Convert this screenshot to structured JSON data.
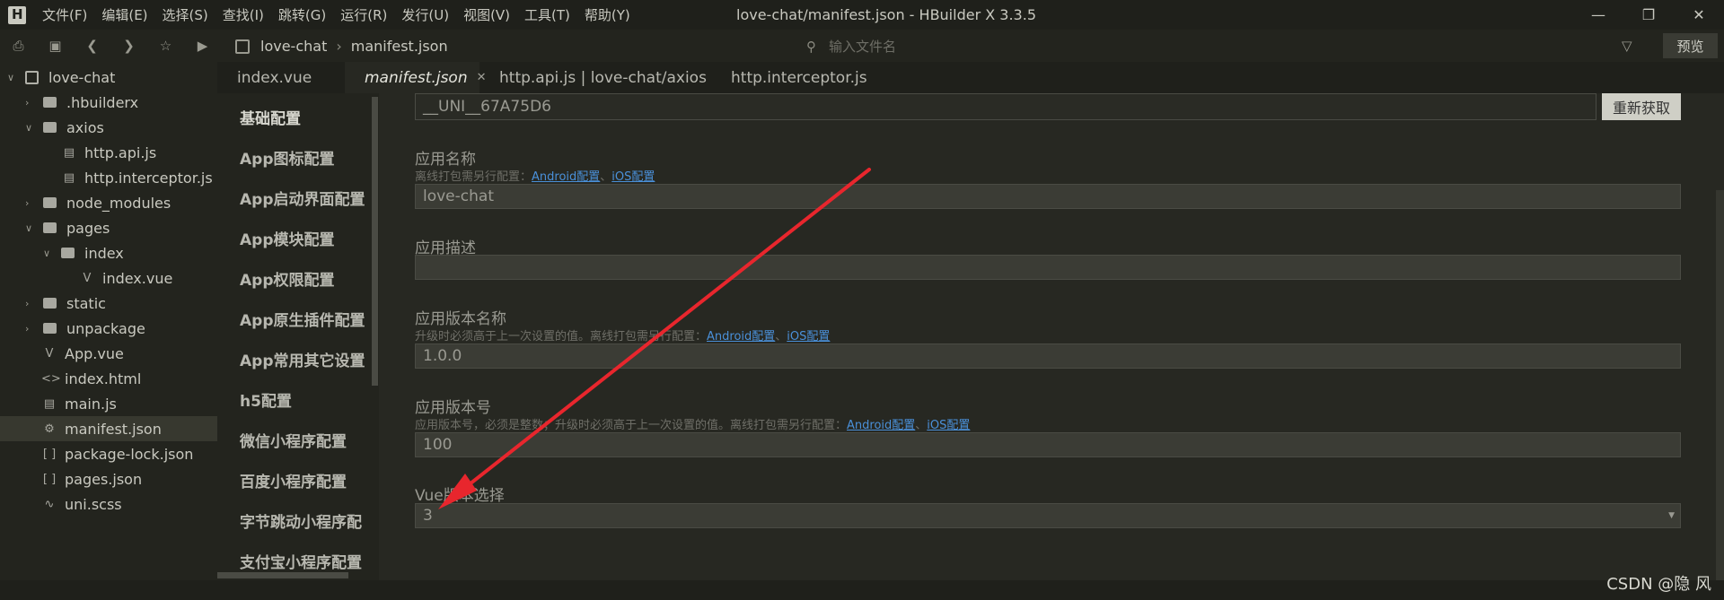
{
  "app": {
    "window_title": "love-chat/manifest.json - HBuilder X 3.3.5",
    "menus": [
      "文件(F)",
      "编辑(E)",
      "选择(S)",
      "查找(I)",
      "跳转(G)",
      "运行(R)",
      "发行(U)",
      "视图(V)",
      "工具(T)",
      "帮助(Y)"
    ]
  },
  "toolbar": {
    "breadcrumb": [
      "love-chat",
      "manifest.json"
    ],
    "file_search_placeholder": "输入文件名",
    "preview_label": "预览"
  },
  "file_tree": [
    {
      "label": "love-chat",
      "type": "project",
      "expanded": true
    },
    {
      "label": ".hbuilderx",
      "type": "folder",
      "expanded": false
    },
    {
      "label": "axios",
      "type": "folder",
      "expanded": true
    },
    {
      "label": "http.api.js",
      "type": "file"
    },
    {
      "label": "http.interceptor.js",
      "type": "file"
    },
    {
      "label": "node_modules",
      "type": "folder",
      "expanded": false
    },
    {
      "label": "pages",
      "type": "folder",
      "expanded": true
    },
    {
      "label": "index",
      "type": "folder",
      "expanded": true
    },
    {
      "label": "index.vue",
      "type": "vue"
    },
    {
      "label": "static",
      "type": "folder",
      "expanded": false
    },
    {
      "label": "unpackage",
      "type": "folder",
      "expanded": false
    },
    {
      "label": "App.vue",
      "type": "vue"
    },
    {
      "label": "index.html",
      "type": "html"
    },
    {
      "label": "main.js",
      "type": "file"
    },
    {
      "label": "manifest.json",
      "type": "config",
      "active": true
    },
    {
      "label": "package-lock.json",
      "type": "json"
    },
    {
      "label": "pages.json",
      "type": "json"
    },
    {
      "label": "uni.scss",
      "type": "scss"
    }
  ],
  "tabs": [
    {
      "label": "index.vue"
    },
    {
      "label": "manifest.json",
      "active": true
    },
    {
      "label": "http.api.js | love-chat/axios"
    },
    {
      "label": "http.interceptor.js"
    }
  ],
  "settings_nav": [
    "基础配置",
    "App图标配置",
    "App启动界面配置",
    "App模块配置",
    "App权限配置",
    "App原生插件配置",
    "App常用其它设置",
    "h5配置",
    "微信小程序配置",
    "百度小程序配置",
    "字节跳动小程序配",
    "支付宝小程序配置"
  ],
  "form": {
    "appid_value": "__UNI__67A75D6",
    "refresh_label": "重新获取",
    "app_name": {
      "label": "应用名称",
      "hint": "离线打包需另行配置：",
      "link1": "Android配置",
      "sep": "、",
      "link2": "iOS配置",
      "value": "love-chat"
    },
    "app_desc": {
      "label": "应用描述",
      "value": ""
    },
    "version_name": {
      "label": "应用版本名称",
      "hint": "升级时必须高于上一次设置的值。离线打包需另行配置：",
      "link1": "Android配置",
      "sep": "、",
      "link2": "iOS配置",
      "value": "1.0.0"
    },
    "version_code": {
      "label": "应用版本号",
      "hint": "应用版本号，必须是整数；升级时必须高于上一次设置的值。离线打包需另行配置：",
      "link1": "Android配置",
      "sep": "、",
      "link2": "iOS配置",
      "value": "100"
    },
    "vue_version": {
      "label": "Vue版本选择",
      "value": "3"
    }
  },
  "watermark": "CSDN @隐 风",
  "colors": {
    "annotation_arrow": "#e8262d",
    "link": "#4a90d9"
  }
}
